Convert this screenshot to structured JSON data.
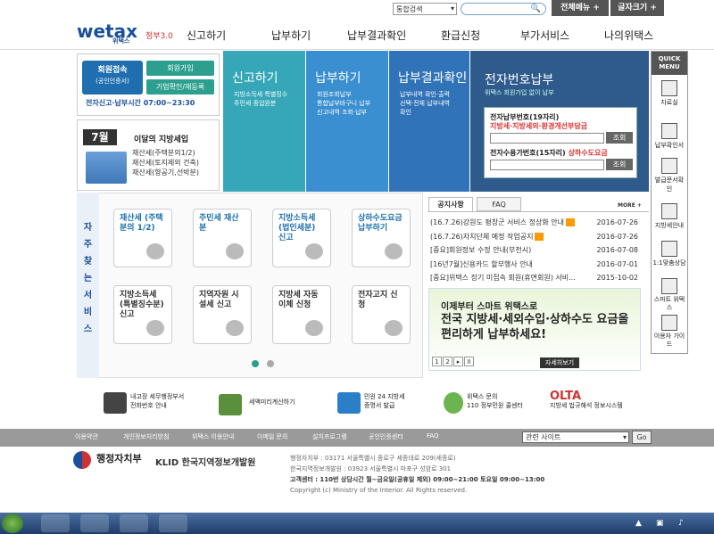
{
  "top": {
    "select_value": "통합검색",
    "menu_all": "전체메뉴 +",
    "font_size": "글자크기 +"
  },
  "header": {
    "logo_text": "wetax",
    "logo_sub": "위택스",
    "logo_30": "정부3.0",
    "nav": [
      "신고하기",
      "납부하기",
      "납부결과확인",
      "환급신청",
      "부가서비스",
      "나의위택스"
    ]
  },
  "login": {
    "cert_login": "회원접속",
    "cert_sub": "(공인인증서)",
    "join": "회원가입",
    "cert_check": "기업확인/재등록",
    "hours": "전자신고·납부시간 07:00~23:30"
  },
  "calendar": {
    "month": "7월",
    "title": "이달의 지방세입",
    "items": [
      "재산세(주택분의1/2)",
      "재산세(토지제외 건축)",
      "재산세(항공기,선박분)"
    ]
  },
  "panels": [
    {
      "title": "신고하기",
      "items": [
        "지방소득세 특별징수",
        "주민세 종업원분"
      ],
      "color": "#36a7b8"
    },
    {
      "title": "납부하기",
      "items": [
        "회원조회납부",
        "통합납부바구니 납부",
        "신고내역 조회·납부"
      ],
      "color": "#3a8fd0"
    },
    {
      "title": "납부결과확인",
      "items": [
        "납부내역 확인·출력",
        "선택·전체 납부내역",
        "확인"
      ],
      "color": "#3173b8"
    }
  ],
  "ebill": {
    "title": "전자번호납부",
    "sub": "위택스 회원가입 없이 납부",
    "label1": "전자납부번호(19자리)",
    "label1_sub": "지방세·지방세외·환경개선부담금",
    "label2": "전자수용가번호(15자리)",
    "label2_sub": "상하수도요금",
    "btn": "조회"
  },
  "quick": {
    "head": "QUICK MENU",
    "items": [
      "자료실",
      "납부확인서",
      "발급문서확인",
      "지방세안내",
      "1:1맞춤상담",
      "스마트 위택스",
      "이용자 가이드"
    ]
  },
  "tiles": {
    "sidebar": [
      "자",
      "주",
      "찾",
      "는",
      "서",
      "비",
      "스"
    ],
    "row1": [
      "재산세 (주택분의 1/2)",
      "주민세 재산분",
      "지방소득세 (법인세분) 신고",
      "상하수도요금 납부하기"
    ],
    "row2": [
      "지방소득세 (특별징수분) 신고",
      "지역자원 시설세 신고",
      "지방세 자동이체 신청",
      "전자고지 신청"
    ]
  },
  "news": {
    "tab1": "공지사항",
    "tab2": "FAQ",
    "more": "MORE +",
    "items": [
      {
        "t": "(16.7.26)강원도 평창군 서비스 정상화 안내",
        "d": "2016-07-26"
      },
      {
        "t": "(16.7.26)자치단체 예정 작업공지",
        "d": "2016-07-26"
      },
      {
        "t": "[중요]회원정보 수정 안내(부천시)",
        "d": "2016-07-08"
      },
      {
        "t": "[16년7월]신용카드 할부행사 안내",
        "d": "2016-07-01"
      },
      {
        "t": "[중요]위택스 장기 미접속 회원(휴면회원) 서비...",
        "d": "2015-10-02"
      }
    ]
  },
  "banner": {
    "line1": "이제부터 스마트 위택스로",
    "line2": "전국 지방세·세외수입·상하수도 요금을",
    "line3": "편리하게 납부하세요!",
    "pages": [
      "1",
      "2",
      "▸",
      "II"
    ],
    "detail": "자세히보기"
  },
  "bottom_banners": [
    {
      "t1": "내고장 세무행정부서",
      "t2": "전화번호 안내"
    },
    {
      "t1": "세액미리계산하기",
      "t2": ""
    },
    {
      "t1": "민원 24 지방세",
      "t2": "증명서 발급"
    },
    {
      "t1": "위택스 문의",
      "t2": "110 정부민원 콜센터"
    },
    {
      "t1": "OLTA",
      "t2": "지방세 법규해석 정보시스템"
    }
  ],
  "footer": {
    "links": [
      "이용약관",
      "개인정보처리방침",
      "위택스 이용안내",
      "이메일 문의",
      "설치프로그램",
      "공인인증센터",
      "FAQ"
    ],
    "site_select": "관련 사이트",
    "go": "Go",
    "mois": "행정자치부",
    "klid": "KLID 한국지역정보개발원",
    "addr1": "행정자치부 : 03171 서울특별시 종로구 세종대로 209(세종로)",
    "addr2": "한국지역정보개발원 : 03923 서울특별시 마포구 성암로 301",
    "addr3": "고객센터 : 110번 상담시간 월~금요일(공휴일 제외) 09:00~21:00 토요일 09:00~13:00",
    "copyright": "Copyright (c) Ministry of the Interior. All Rights reserved."
  }
}
